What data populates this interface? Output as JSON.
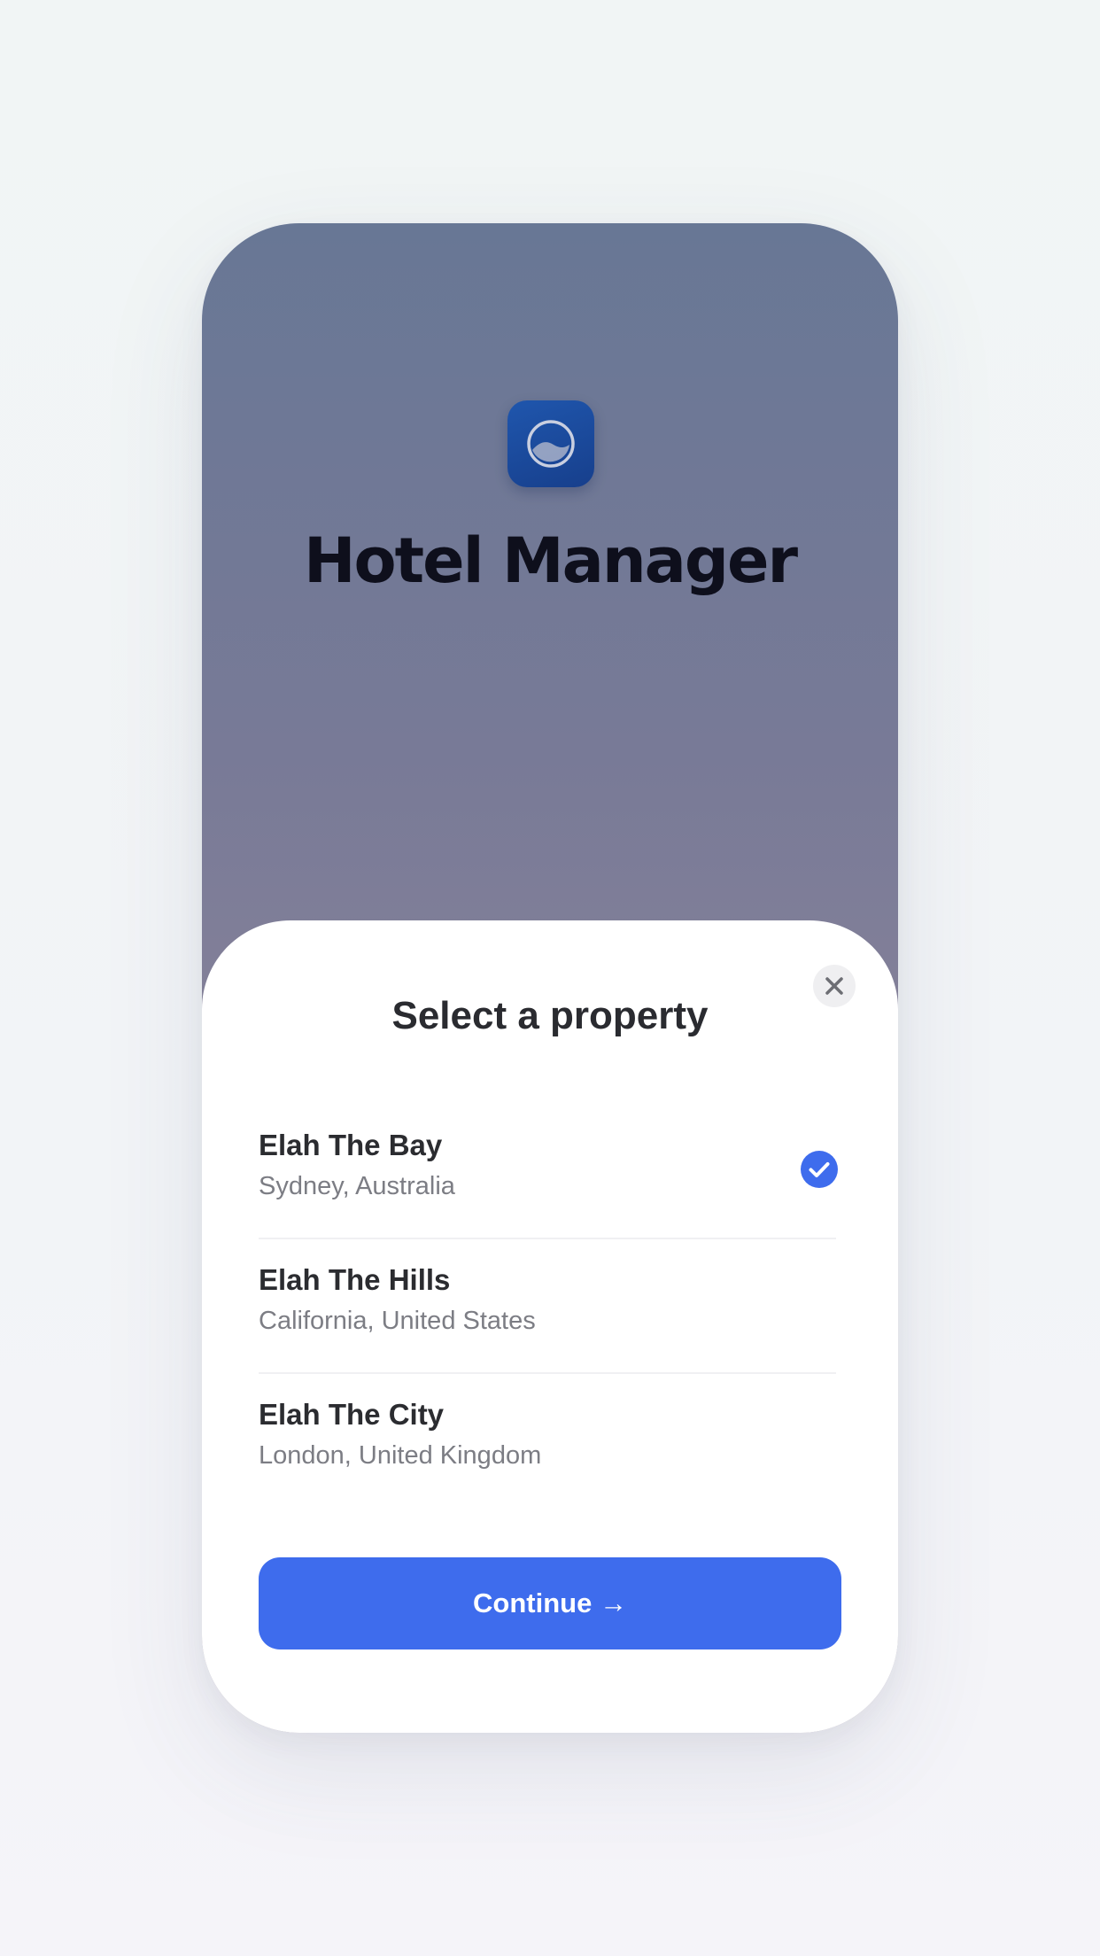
{
  "app": {
    "title": "Hotel Manager",
    "icon": "moon-logo-icon"
  },
  "sheet": {
    "title": "Select a property",
    "close_icon": "close-icon",
    "continue_label": "Continue →",
    "accent_color": "#3e6ced",
    "properties": [
      {
        "name": "Elah The Bay",
        "location": "Sydney, Australia",
        "selected": true
      },
      {
        "name": "Elah The Hills",
        "location": "California, United States",
        "selected": false
      },
      {
        "name": "Elah The City",
        "location": "London, United Kingdom",
        "selected": false
      }
    ]
  }
}
